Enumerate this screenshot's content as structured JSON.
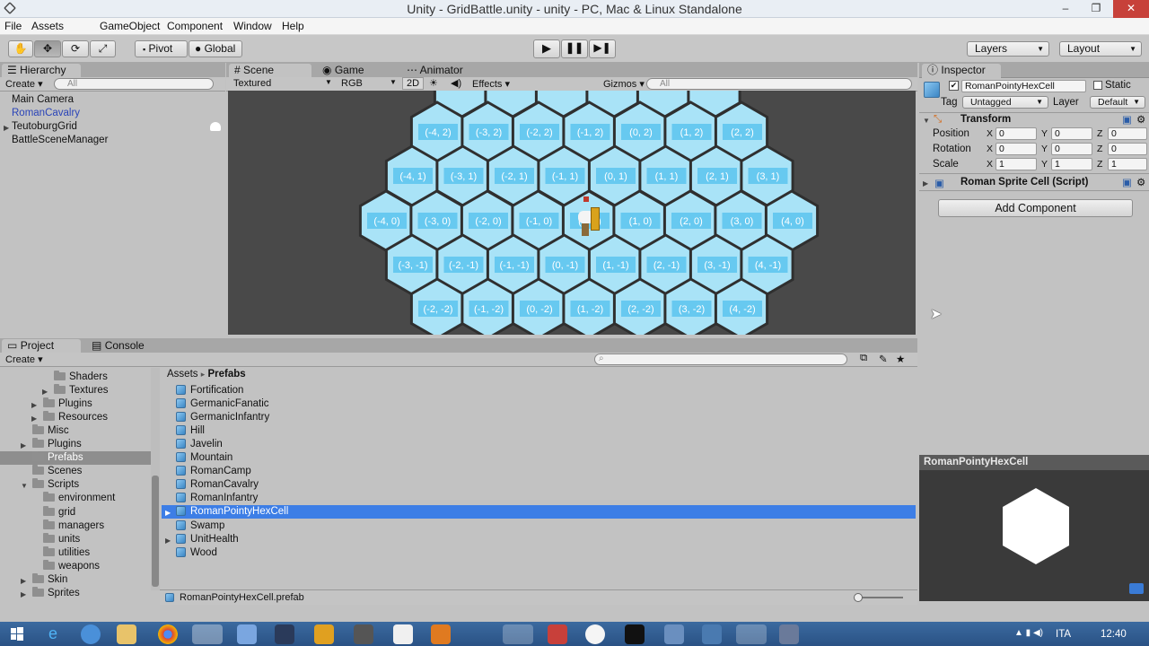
{
  "window": {
    "title": "Unity - GridBattle.unity - unity - PC, Mac & Linux Standalone",
    "minimize": "–",
    "maximize": "❐",
    "close": "✕"
  },
  "menu": [
    "File",
    "Assets",
    "GameObject",
    "Component",
    "Window",
    "Help"
  ],
  "toolbar": {
    "pivot": "Pivot",
    "global": "Global",
    "layers": "Layers",
    "layout": "Layout"
  },
  "hierarchy": {
    "tab": "Hierarchy",
    "create": "Create",
    "search_placeholder": "All",
    "items": [
      "Main Camera",
      "RomanCavalry",
      "TeutoburgGrid",
      "BattleSceneManager"
    ]
  },
  "scene_tabs": {
    "scene": "Scene",
    "game": "Game",
    "animator": "Animator",
    "shading": "Textured",
    "render_mode": "RGB",
    "mode_2d": "2D",
    "effects": "Effects",
    "gizmos": "Gizmos",
    "search_placeholder": "All"
  },
  "hex_rows": [
    [
      "(-4, 2)",
      "(-3, 2)",
      "(-2, 2)",
      "(-1, 2)",
      "(0, 2)",
      "(1, 2)",
      "(2, 2)"
    ],
    [
      "(-4, 1)",
      "(-3, 1)",
      "(-2, 1)",
      "(-1, 1)",
      "(0, 1)",
      "(1, 1)",
      "(2, 1)",
      "(3, 1)"
    ],
    [
      "(-4, 0)",
      "(-3, 0)",
      "(-2, 0)",
      "(-1, 0)",
      "(0, 0)",
      "(1, 0)",
      "(2, 0)",
      "(3, 0)",
      "(4, 0)"
    ],
    [
      "(-3, -1)",
      "(-2, -1)",
      "(-1, -1)",
      "(0, -1)",
      "(1, -1)",
      "(2, -1)",
      "(3, -1)",
      "(4, -1)"
    ],
    [
      "(-2, -2)",
      "(-1, -2)",
      "(0, -2)",
      "(1, -2)",
      "(2, -2)",
      "(3, -2)",
      "(4, -2)"
    ]
  ],
  "project": {
    "tab": "Project",
    "console_tab": "Console",
    "create": "Create",
    "folders": [
      {
        "label": "Shaders",
        "indent": 3
      },
      {
        "label": "Textures",
        "indent": 3
      },
      {
        "label": "Plugins",
        "indent": 2
      },
      {
        "label": "Resources",
        "indent": 2
      },
      {
        "label": "Misc",
        "indent": 1
      },
      {
        "label": "Plugins",
        "indent": 1
      },
      {
        "label": "Prefabs",
        "indent": 1
      },
      {
        "label": "Scenes",
        "indent": 1
      },
      {
        "label": "Scripts",
        "indent": 1
      },
      {
        "label": "environment",
        "indent": 2
      },
      {
        "label": "grid",
        "indent": 2
      },
      {
        "label": "managers",
        "indent": 2
      },
      {
        "label": "units",
        "indent": 2
      },
      {
        "label": "utilities",
        "indent": 2
      },
      {
        "label": "weapons",
        "indent": 2
      },
      {
        "label": "Skin",
        "indent": 1
      },
      {
        "label": "Sprites",
        "indent": 1
      }
    ],
    "breadcrumb_root": "Assets",
    "breadcrumb_sep": "▸",
    "breadcrumb_current": "Prefabs",
    "assets": [
      "Fortification",
      "GermanicFanatic",
      "GermanicInfantry",
      "Hill",
      "Javelin",
      "Mountain",
      "RomanCamp",
      "RomanCavalry",
      "RomanInfantry",
      "RomanPointyHexCell",
      "Swamp",
      "UnitHealth",
      "Wood"
    ],
    "selected_asset": "RomanPointyHexCell",
    "footer_path": "RomanPointyHexCell.prefab"
  },
  "inspector": {
    "tab": "Inspector",
    "object_name": "RomanPointyHexCell",
    "static_label": "Static",
    "tag_label": "Tag",
    "tag_value": "Untagged",
    "layer_label": "Layer",
    "layer_value": "Default",
    "transform_title": "Transform",
    "position_label": "Position",
    "rotation_label": "Rotation",
    "scale_label": "Scale",
    "axis_x": "X",
    "axis_y": "Y",
    "axis_z": "Z",
    "position": [
      "0",
      "0",
      "0"
    ],
    "rotation": [
      "0",
      "0",
      "0"
    ],
    "scale": [
      "1",
      "1",
      "1"
    ],
    "script_title": "Roman Sprite Cell (Script)",
    "add_component": "Add Component",
    "preview_title": "RomanPointyHexCell"
  },
  "taskbar": {
    "language": "ITA",
    "time": "12:40"
  },
  "colors": {
    "hex_fill": "#a9e3f7",
    "label_box": "#5cc4ef",
    "selection": "#3d7ee6"
  }
}
